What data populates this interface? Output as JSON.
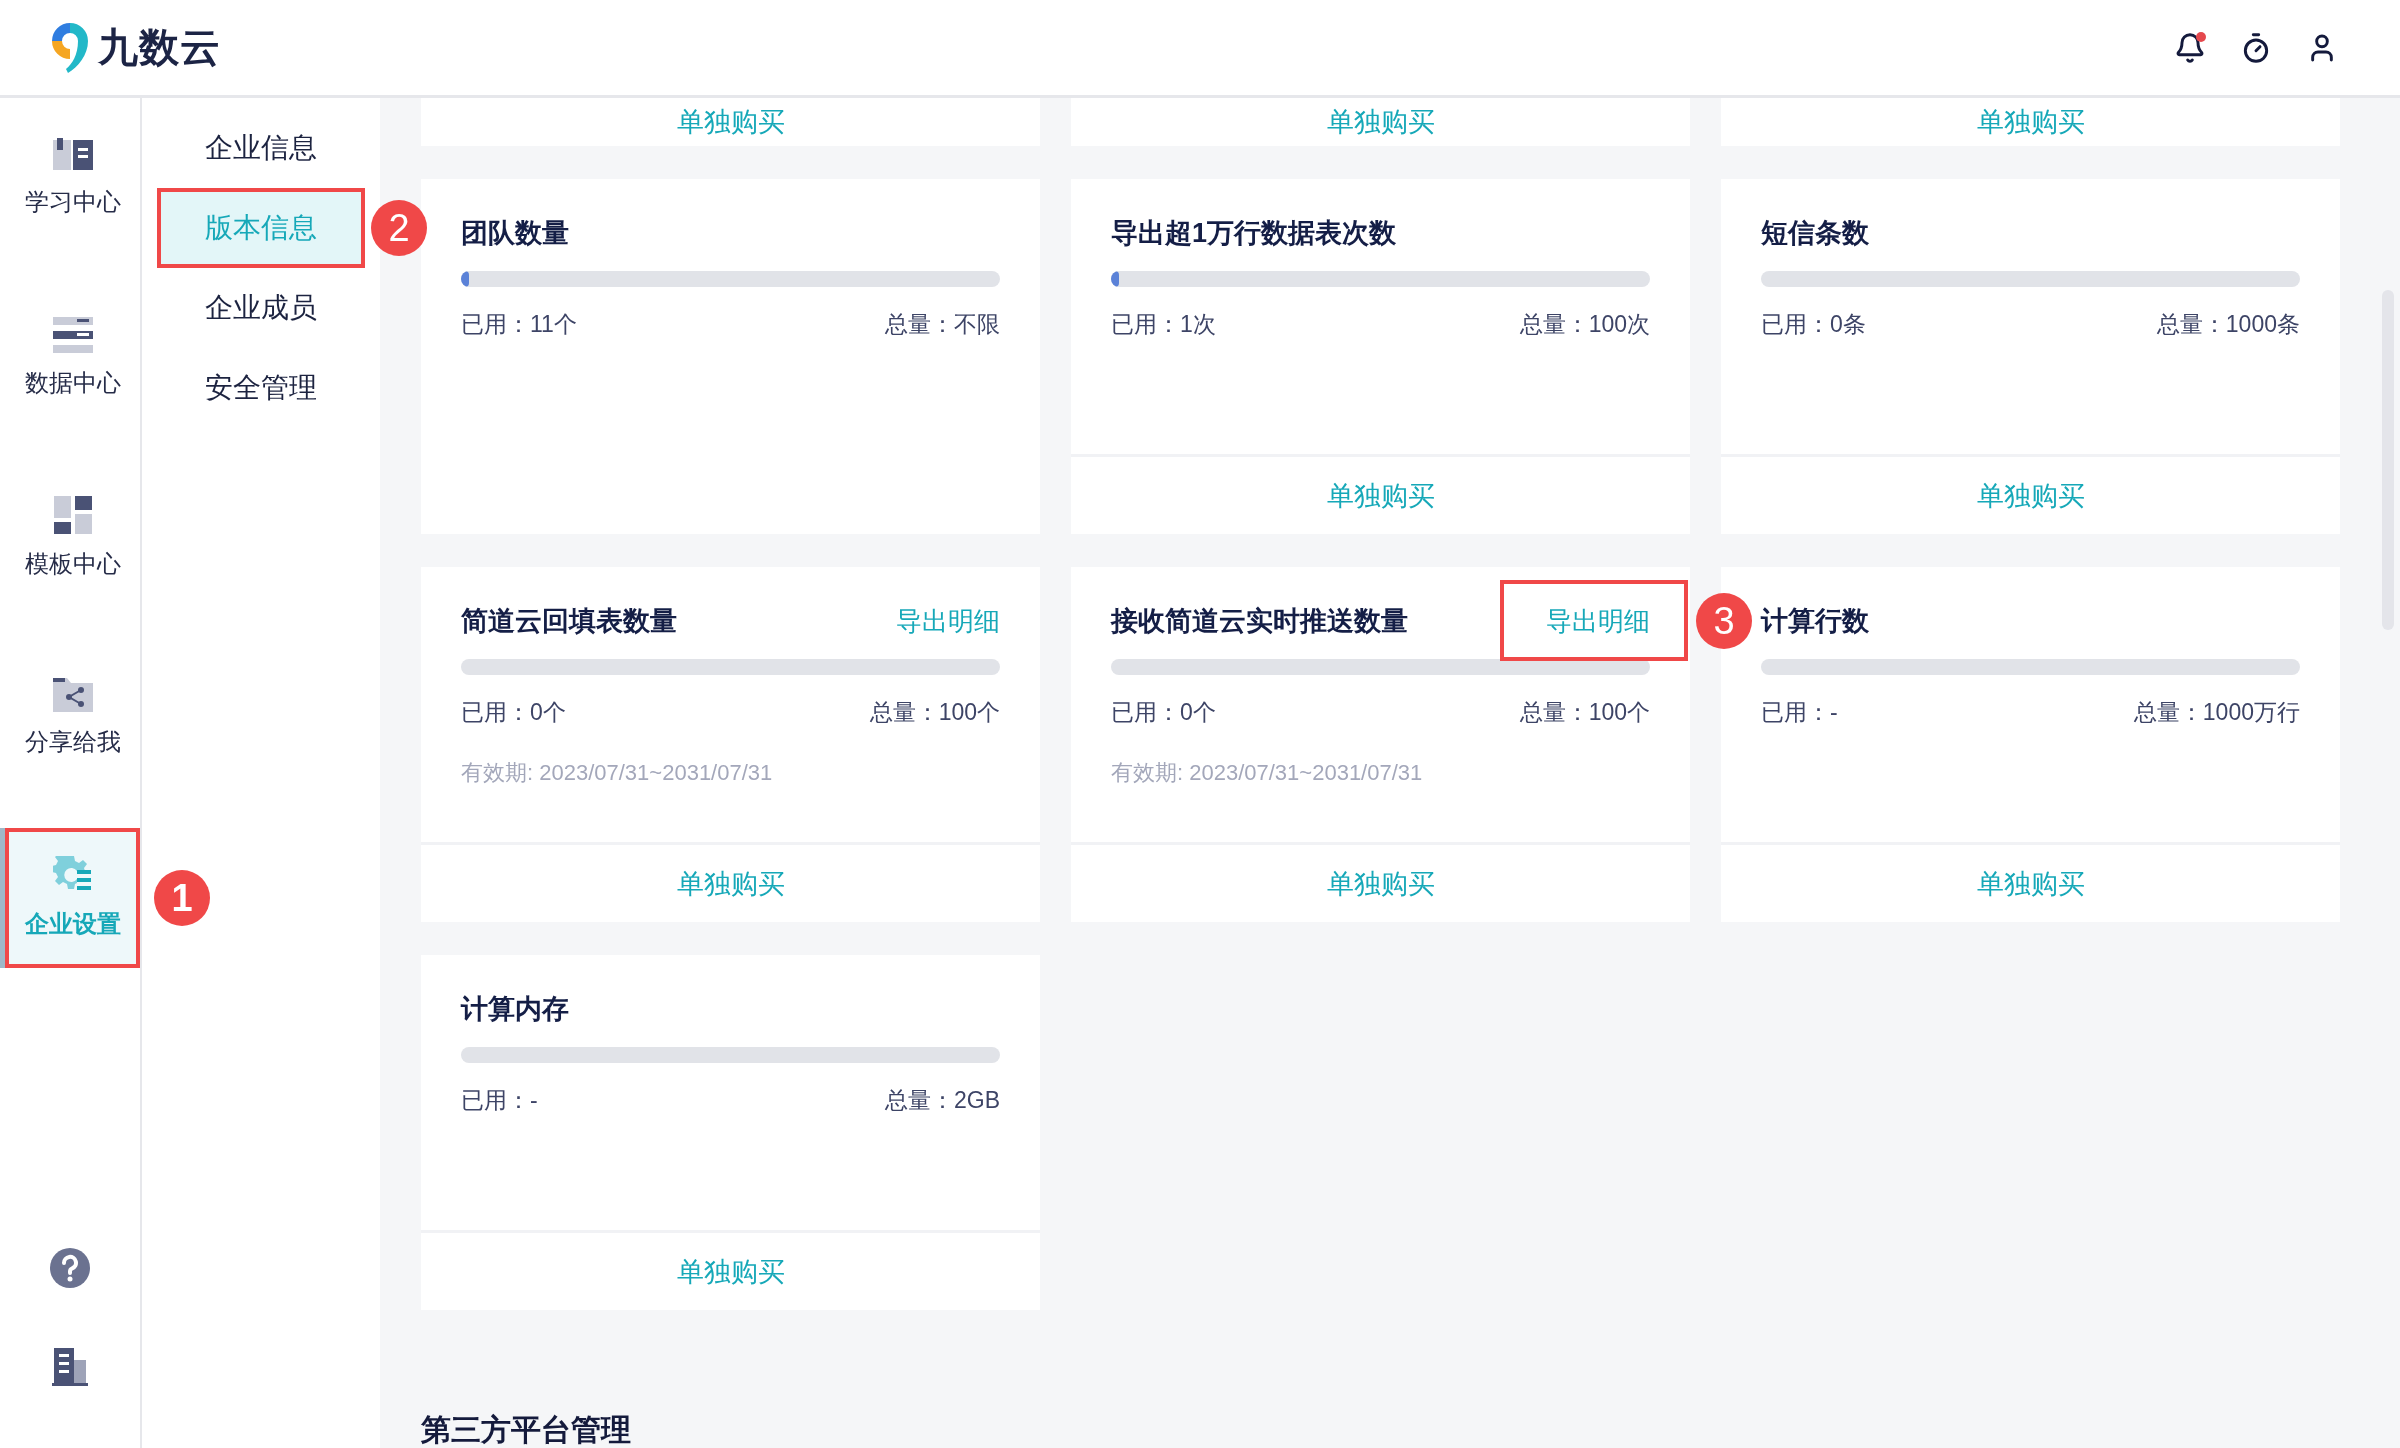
{
  "header": {
    "logo_text": "九数云",
    "notification_dot": true
  },
  "rail": {
    "items": [
      {
        "label": "学习中心",
        "selected": false
      },
      {
        "label": "数据中心",
        "selected": false
      },
      {
        "label": "模板中心",
        "selected": false
      },
      {
        "label": "分享给我",
        "selected": false
      },
      {
        "label": "企业设置",
        "selected": true,
        "callout": "1"
      }
    ]
  },
  "submenu": {
    "items": [
      {
        "label": "企业信息",
        "selected": false
      },
      {
        "label": "版本信息",
        "selected": true,
        "callout": "2"
      },
      {
        "label": "企业成员",
        "selected": false
      },
      {
        "label": "安全管理",
        "selected": false
      }
    ]
  },
  "partial_cards": [
    {
      "action": "单独购买"
    },
    {
      "action": "单独购买"
    },
    {
      "action": "单独购买"
    }
  ],
  "cards": [
    {
      "title": "团队数量",
      "level": 0.015,
      "used": "已用：11个",
      "total": "总量：不限"
    },
    {
      "title": "导出超1万行数据表次数",
      "level": 0.01,
      "used": "已用：1次",
      "total": "总量：100次",
      "action": "单独购买"
    },
    {
      "title": "短信条数",
      "used": "已用：0条",
      "total": "总量：1000条",
      "action": "单独购买"
    },
    {
      "title": "简道云回填表数量",
      "export_link": "导出明细",
      "used": "已用：0个",
      "total": "总量：100个",
      "validity": "有效期: 2023/07/31~2031/07/31",
      "action": "单独购买"
    },
    {
      "title": "接收简道云实时推送数量",
      "export_link": "导出明细",
      "export_callout": "3",
      "used": "已用：0个",
      "total": "总量：100个",
      "validity": "有效期: 2023/07/31~2031/07/31",
      "action": "单独购买"
    },
    {
      "title": "计算行数",
      "used": "已用：-",
      "total": "总量：1000万行",
      "action": "单独购买"
    },
    {
      "title": "计算内存",
      "used": "已用：-",
      "total": "总量：2GB",
      "action": "单独购买"
    }
  ],
  "section_heading": "第三方平台管理"
}
